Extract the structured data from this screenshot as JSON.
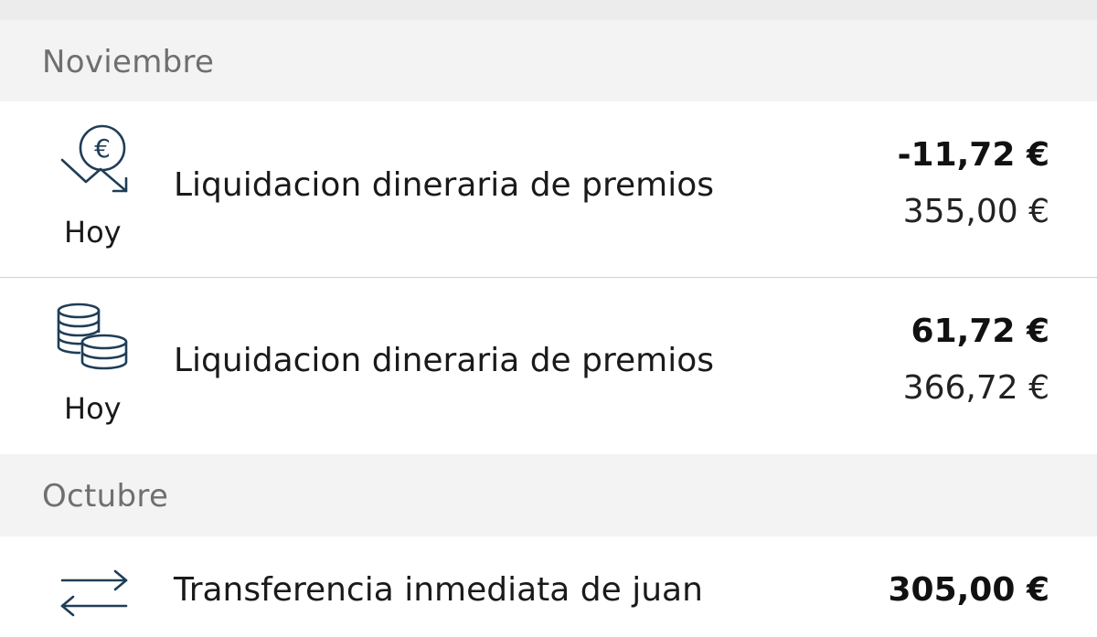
{
  "sections": [
    {
      "month": "Noviembre",
      "transactions": [
        {
          "icon": "euro-down-arrow-icon",
          "date": "Hoy",
          "title": "Liquidacion dineraria de premios",
          "amount": "-11,72 €",
          "balance": "355,00 €"
        },
        {
          "icon": "coins-stack-icon",
          "date": "Hoy",
          "title": "Liquidacion dineraria de premios",
          "amount": "61,72 €",
          "balance": "366,72 €"
        }
      ]
    },
    {
      "month": "Octubre",
      "transactions": [
        {
          "icon": "transfer-arrows-icon",
          "title": "Transferencia inmediata de juan",
          "amount": "305,00 €"
        }
      ]
    }
  ],
  "colors": {
    "icon": "#1f3d57",
    "section_bg": "#f3f3f3",
    "section_text": "#6f6f6f"
  }
}
